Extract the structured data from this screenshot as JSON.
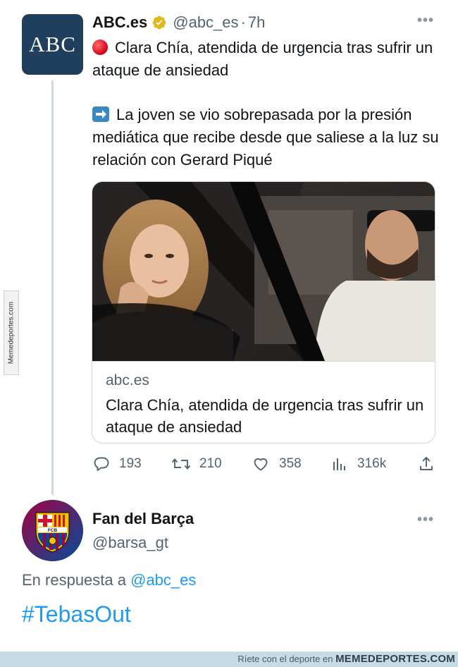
{
  "tweet": {
    "author_name": "ABC.es",
    "avatar_text": "ABC",
    "handle": "@abc_es",
    "separator": "·",
    "time": "7h",
    "more": "•••",
    "paragraph1": "Clara Chía, atendida de urgencia tras sufrir un ataque de ansiedad",
    "paragraph2": "La joven se vio sobrepasada por la presión mediática que recibe desde que saliese a la luz su relación con Gerard Piqué",
    "emoji1_icon": "red-circle-icon",
    "emoji2_icon": "right-arrow-icon",
    "card": {
      "domain": "abc.es",
      "title": "Clara Chía, atendida de urgencia tras sufrir un ataque de ansiedad"
    },
    "actions": {
      "replies": "193",
      "retweets": "210",
      "likes": "358",
      "views": "316k"
    }
  },
  "reply": {
    "author_name": "Fan del Barça",
    "handle": "@barsa_gt",
    "more": "•••",
    "in_reply_prefix": "En respuesta a",
    "in_reply_mention": "@abc_es",
    "text": "#TebasOut",
    "avatar_text": "FCB"
  },
  "watermark": {
    "side": "Memedeportes.com",
    "footer_prefix": "Ríete con el deporte en",
    "footer_brand": "MEMEDEPORTES.COM"
  },
  "colors": {
    "link": "#1d9bf0",
    "muted": "#536471",
    "verified_gold": "#e2b719",
    "abc_avatar": "#1f3f5c"
  }
}
